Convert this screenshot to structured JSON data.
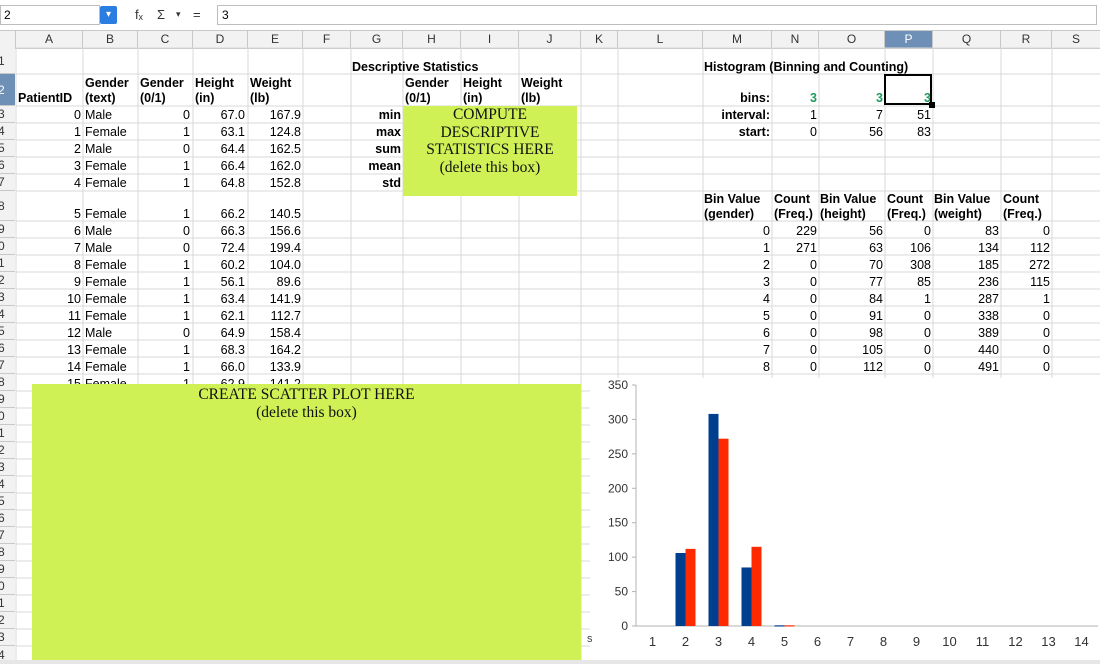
{
  "name_box": "2",
  "formula": "3",
  "fb_icons": {
    "function": "fₓ",
    "sum": "Σ",
    "sum_dd": "▾",
    "equals": "="
  },
  "columns": [
    "A",
    "B",
    "C",
    "D",
    "E",
    "F",
    "G",
    "H",
    "I",
    "J",
    "K",
    "L",
    "M",
    "N",
    "O",
    "P",
    "Q",
    "R",
    "S"
  ],
  "row_labels": [
    "1",
    "2",
    "3",
    "4",
    "5",
    "6",
    "7",
    "8",
    "9",
    "0",
    "1",
    "2",
    "3",
    "4",
    "5",
    "6",
    "7",
    "8",
    "9",
    "0",
    "1",
    "2",
    "3",
    "4",
    "5",
    "6",
    "7",
    "8",
    "9",
    "0",
    "1",
    "2",
    "3",
    "4"
  ],
  "headers": {
    "patient_id": "PatientID",
    "gender_text_1": "Gender",
    "gender_text_2": "(text)",
    "gender01_1": "Gender",
    "gender01_2": "(0/1)",
    "height_1": "Height",
    "height_2": "(in)",
    "weight_1": "Weight",
    "weight_2": "(lb)"
  },
  "patients": [
    {
      "id": "0",
      "gender": "Male",
      "g01": "0",
      "height": "67.0",
      "weight": "167.9"
    },
    {
      "id": "1",
      "gender": "Female",
      "g01": "1",
      "height": "63.1",
      "weight": "124.8"
    },
    {
      "id": "2",
      "gender": "Male",
      "g01": "0",
      "height": "64.4",
      "weight": "162.5"
    },
    {
      "id": "3",
      "gender": "Female",
      "g01": "1",
      "height": "66.4",
      "weight": "162.0"
    },
    {
      "id": "4",
      "gender": "Female",
      "g01": "1",
      "height": "64.8",
      "weight": "152.8"
    },
    {
      "id": "5",
      "gender": "Female",
      "g01": "1",
      "height": "66.2",
      "weight": "140.5"
    },
    {
      "id": "6",
      "gender": "Male",
      "g01": "0",
      "height": "66.3",
      "weight": "156.6"
    },
    {
      "id": "7",
      "gender": "Male",
      "g01": "0",
      "height": "72.4",
      "weight": "199.4"
    },
    {
      "id": "8",
      "gender": "Female",
      "g01": "1",
      "height": "60.2",
      "weight": "104.0"
    },
    {
      "id": "9",
      "gender": "Female",
      "g01": "1",
      "height": "56.1",
      "weight": "89.6"
    },
    {
      "id": "10",
      "gender": "Female",
      "g01": "1",
      "height": "63.4",
      "weight": "141.9"
    },
    {
      "id": "11",
      "gender": "Female",
      "g01": "1",
      "height": "62.1",
      "weight": "112.7"
    },
    {
      "id": "12",
      "gender": "Male",
      "g01": "0",
      "height": "64.9",
      "weight": "158.4"
    },
    {
      "id": "13",
      "gender": "Female",
      "g01": "1",
      "height": "68.3",
      "weight": "164.2"
    },
    {
      "id": "14",
      "gender": "Female",
      "g01": "1",
      "height": "66.0",
      "weight": "133.9"
    },
    {
      "id": "15",
      "gender": "Female",
      "g01": "1",
      "height": "62.9",
      "weight": "141.2"
    }
  ],
  "desc": {
    "title": "Descriptive Statistics",
    "h_gender_1": "Gender",
    "h_gender_2": "(0/1)",
    "h_height_1": "Height",
    "h_height_2": "(in)",
    "h_weight_1": "Weight",
    "h_weight_2": "(lb)",
    "stats": [
      "min",
      "max",
      "sum",
      "mean",
      "std"
    ],
    "box_lines": [
      "COMPUTE",
      "DESCRIPTIVE",
      "STATISTICS HERE",
      "(delete this box)"
    ]
  },
  "hist": {
    "title": "Histogram (Binning and Counting)",
    "bins_label": "bins:",
    "interval_label": "interval:",
    "start_label": "start:",
    "bins": [
      "3",
      "3",
      "3"
    ],
    "interval": [
      "1",
      "7",
      "51"
    ],
    "start": [
      "0",
      "56",
      "83"
    ],
    "col_headers": [
      [
        "Bin Value",
        "(gender)"
      ],
      [
        "Count",
        "(Freq.)"
      ],
      [
        "Bin Value",
        "(height)"
      ],
      [
        "Count",
        "(Freq.)"
      ],
      [
        "Bin Value",
        "(weight)"
      ],
      [
        "Count",
        "(Freq.)"
      ]
    ],
    "rows": [
      [
        "0",
        "229",
        "56",
        "0",
        "83",
        "0"
      ],
      [
        "1",
        "271",
        "63",
        "106",
        "134",
        "112"
      ],
      [
        "2",
        "0",
        "70",
        "308",
        "185",
        "272"
      ],
      [
        "3",
        "0",
        "77",
        "85",
        "236",
        "115"
      ],
      [
        "4",
        "0",
        "84",
        "1",
        "287",
        "1"
      ],
      [
        "5",
        "0",
        "91",
        "0",
        "338",
        "0"
      ],
      [
        "6",
        "0",
        "98",
        "0",
        "389",
        "0"
      ],
      [
        "7",
        "0",
        "105",
        "0",
        "440",
        "0"
      ],
      [
        "8",
        "0",
        "112",
        "0",
        "491",
        "0"
      ]
    ]
  },
  "scatter_box": [
    "CREATE SCATTER PLOT HERE",
    "(delete this box)"
  ],
  "chart_partial_label": "s",
  "colors": {
    "green_box": "#cff155",
    "series_blue": "#003f8e",
    "series_red": "#ff2a00",
    "selected_header": "#6e8fb6"
  },
  "chart_data": {
    "type": "bar",
    "categories": [
      "1",
      "2",
      "3",
      "4",
      "5",
      "6",
      "7",
      "8",
      "9",
      "10",
      "11",
      "12",
      "13",
      "14"
    ],
    "series": [
      {
        "values": [
          0,
          106,
          308,
          85,
          1,
          0,
          0,
          0,
          0,
          0,
          0,
          0,
          0,
          0
        ]
      },
      {
        "values": [
          0,
          112,
          272,
          115,
          1,
          0,
          0,
          0,
          0,
          0,
          0,
          0,
          0,
          0
        ]
      }
    ],
    "ylim": [
      0,
      350
    ],
    "yticks": [
      0,
      50,
      100,
      150,
      200,
      250,
      300,
      350
    ],
    "grid": false,
    "legend": "none"
  }
}
